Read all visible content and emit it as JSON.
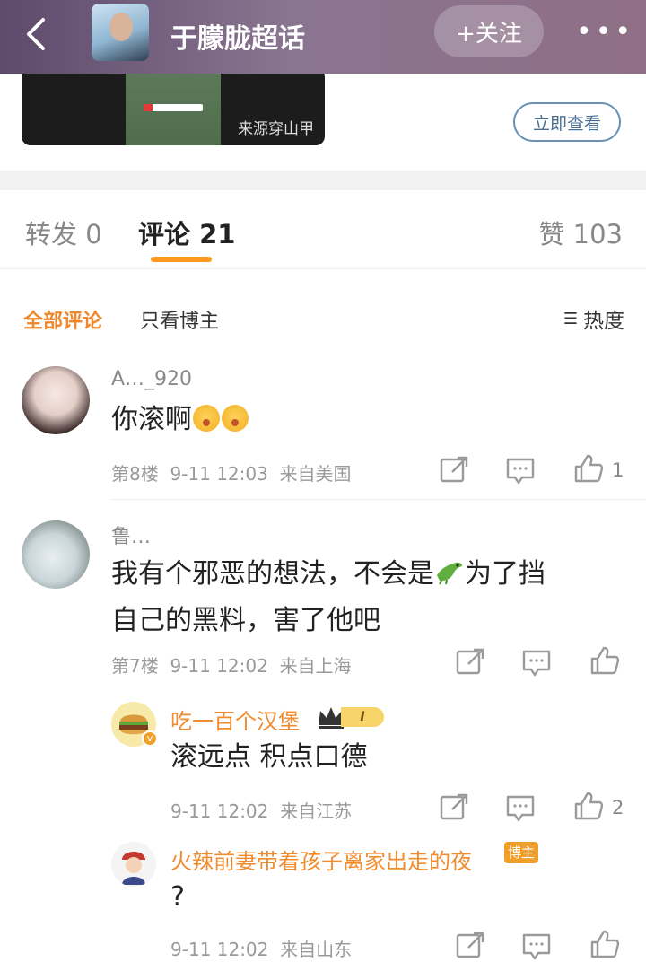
{
  "header": {
    "title": "于朦胧超话",
    "follow_label": "+关注",
    "more_icon": "more-icon"
  },
  "card": {
    "video_source": "来源穿山甲",
    "view_label": "立即查看"
  },
  "tabs": {
    "repost": "转发 0",
    "comment": "评论 21",
    "like": "赞 103"
  },
  "filter": {
    "all": "全部评论",
    "owner_only": "只看博主",
    "sort": "热度"
  },
  "comments": [
    {
      "username": "A…_920",
      "text": "你滚啊",
      "floor": "第8楼",
      "time": "9-11 12:03",
      "location": "来自美国",
      "likes": "1"
    },
    {
      "username": "鲁…",
      "text_line1_a": "我有个邪恶的想法，不会是",
      "text_line1_b": "为了挡",
      "text_line2": "自己的黑料，害了他吧",
      "floor": "第7楼",
      "time": "9-11 12:02",
      "location": "来自上海",
      "likes": ""
    }
  ],
  "replies": [
    {
      "username": "吃一百个汉堡",
      "level": "I",
      "text": "滚远点 积点口德",
      "time": "9-11 12:02",
      "location": "来自江苏",
      "likes": "2"
    },
    {
      "username": "火辣前妻带着孩子离家出走的夜",
      "badge": "博主",
      "text": "?",
      "time": "9-11 12:02",
      "location": "来自山东",
      "likes": ""
    }
  ],
  "colors": {
    "accent": "#f0882a",
    "header_bg": "#7a6680",
    "badge": "#f0a02a"
  }
}
